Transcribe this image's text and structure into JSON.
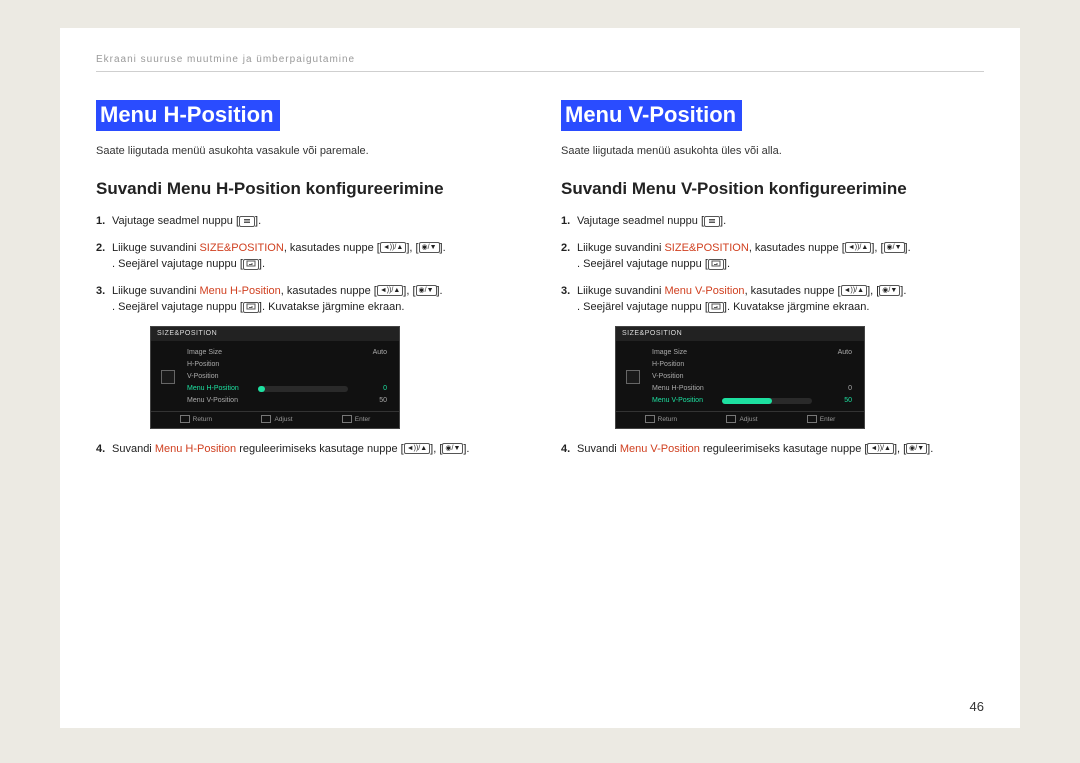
{
  "chapter": "Ekraani suuruse muutmine ja ümberpaigutamine",
  "page_number": "46",
  "icons": {
    "menu": "▭",
    "vol_up": "◄))/▲",
    "vol_dn": "◉/▼",
    "enter": "⏎"
  },
  "osd": {
    "title": "SIZE&POSITION",
    "items": [
      {
        "label": "Image Size",
        "value": "Auto"
      },
      {
        "label": "H-Position",
        "value": ""
      },
      {
        "label": "V-Position",
        "value": ""
      },
      {
        "label": "Menu H-Position",
        "value": "0"
      },
      {
        "label": "Menu V-Position",
        "value": "50"
      }
    ],
    "footer": [
      "Return",
      "Adjust",
      "Enter"
    ]
  },
  "left": {
    "title": "Menu H-Position",
    "intro": "Saate liigutada menüü asukohta vasakule või paremale.",
    "subtitle": "Suvandi Menu H-Position konfigureerimine",
    "step1": "Vajutage seadmel nuppu ",
    "step2a": "Liikuge suvandini ",
    "step2_red": "SIZE&POSITION",
    "step2b": ", kasutades nuppe ",
    "step2c": ". Seejärel vajutage nuppu ",
    "step3a": "Liikuge suvandini ",
    "step3_red": "Menu H-Position",
    "step3b": ", kasutades nuppe ",
    "step3c": ". Seejärel vajutage nuppu ",
    "step3d": ". Kuvatakse järgmine ekraan.",
    "step4a": "Suvandi ",
    "step4_red": "Menu H-Position",
    "step4b": " reguleerimiseks kasutage nuppe ",
    "osd_selected": 3,
    "osd_fill": "8%"
  },
  "right": {
    "title": "Menu V-Position",
    "intro": "Saate liigutada menüü asukohta üles või alla.",
    "subtitle": "Suvandi Menu V-Position konfigureerimine",
    "step1": "Vajutage seadmel nuppu ",
    "step2a": "Liikuge suvandini ",
    "step2_red": "SIZE&POSITION",
    "step2b": ", kasutades nuppe ",
    "step2c": ". Seejärel vajutage nuppu ",
    "step3a": "Liikuge suvandini ",
    "step3_red": "Menu V-Position",
    "step3b": ", kasutades nuppe ",
    "step3c": ". Seejärel vajutage nuppu ",
    "step3d": ".  Kuvatakse järgmine ekraan.",
    "step4a": "Suvandi ",
    "step4_red": "Menu V-Position",
    "step4b": " reguleerimiseks kasutage nuppe ",
    "osd_selected": 4,
    "osd_fill": "55%"
  }
}
